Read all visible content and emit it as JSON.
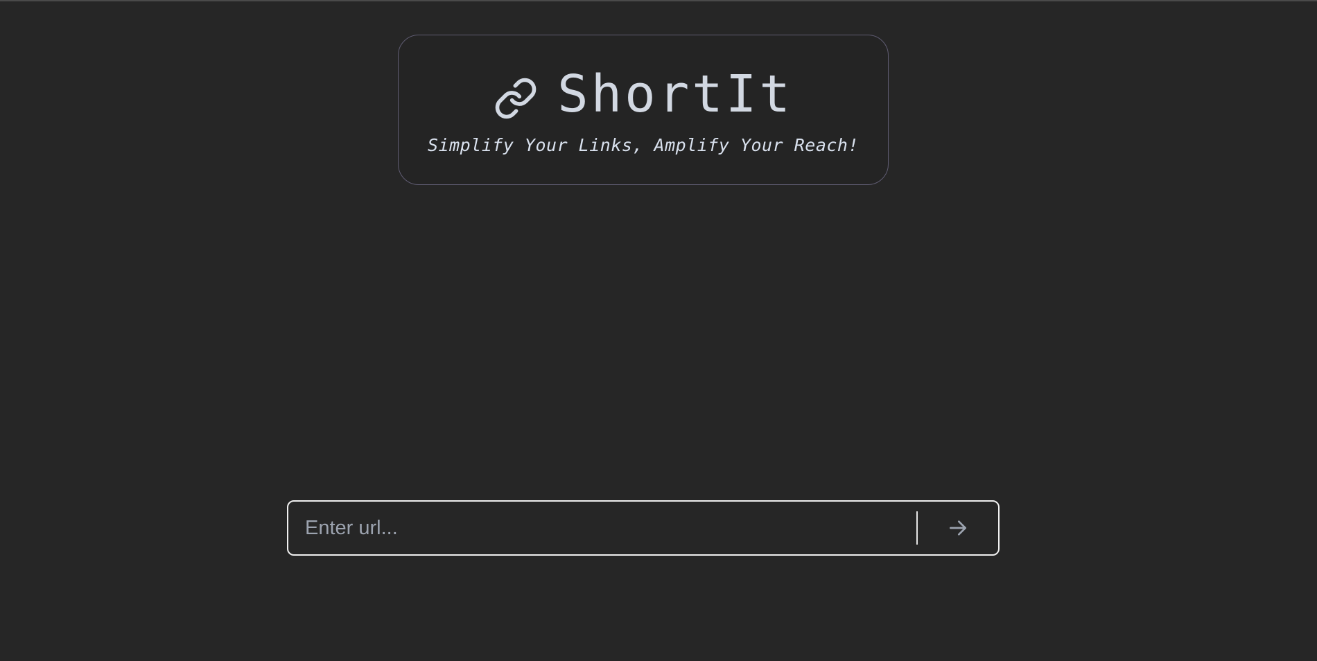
{
  "header": {
    "title": "ShortIt",
    "tagline": "Simplify Your Links, Amplify Your Reach!",
    "icon": "link-icon"
  },
  "url_form": {
    "input_placeholder": "Enter url...",
    "input_value": "",
    "submit_icon": "arrow-right-icon"
  },
  "colors": {
    "background": "#262626",
    "title_text": "#d2d8e2",
    "card_border": "#5f5c72",
    "form_border": "#f0f0f0",
    "placeholder": "#9ca3af",
    "arrow": "#9ca3af"
  }
}
